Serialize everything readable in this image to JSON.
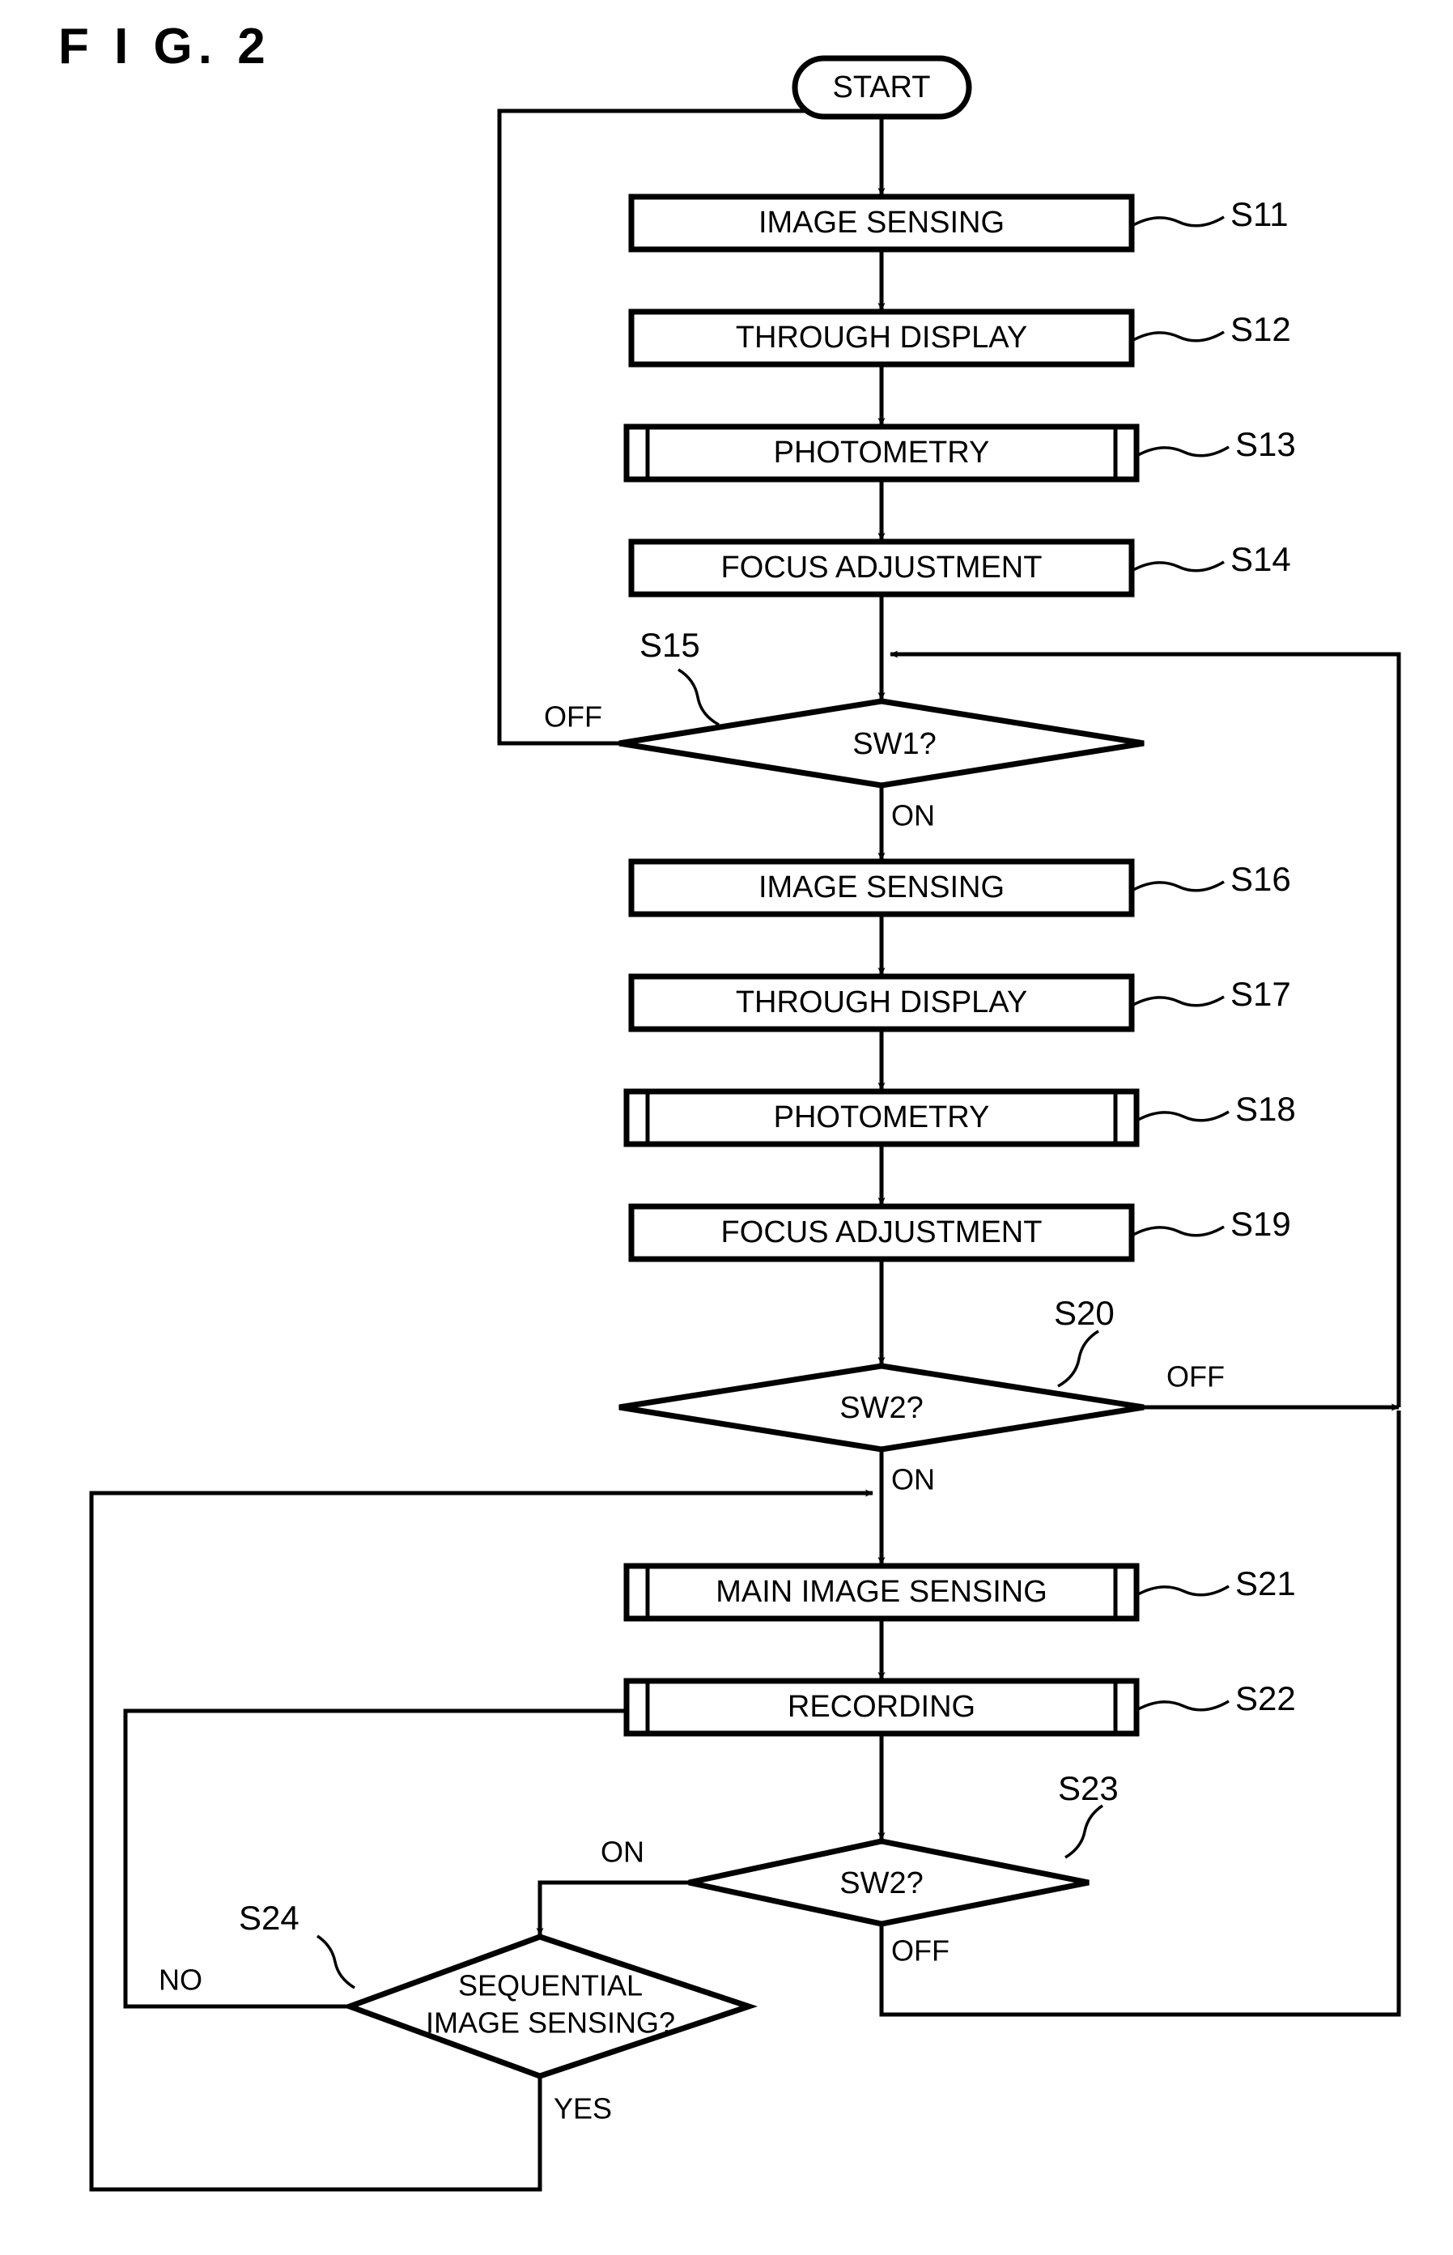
{
  "figure": {
    "title": "F I G.  2"
  },
  "flowchart": {
    "terminal_start": "START",
    "nodes": [
      {
        "id": "S11",
        "text": "IMAGE SENSING",
        "step": "S11",
        "shape": "process"
      },
      {
        "id": "S12",
        "text": "THROUGH DISPLAY",
        "step": "S12",
        "shape": "process"
      },
      {
        "id": "S13",
        "text": "PHOTOMETRY",
        "step": "S13",
        "shape": "predefined-process"
      },
      {
        "id": "S14",
        "text": "FOCUS ADJUSTMENT",
        "step": "S14",
        "shape": "process"
      },
      {
        "id": "S15",
        "text": "SW1?",
        "step": "S15",
        "shape": "decision"
      },
      {
        "id": "S16",
        "text": "IMAGE SENSING",
        "step": "S16",
        "shape": "process"
      },
      {
        "id": "S17",
        "text": "THROUGH DISPLAY",
        "step": "S17",
        "shape": "process"
      },
      {
        "id": "S18",
        "text": "PHOTOMETRY",
        "step": "S18",
        "shape": "predefined-process"
      },
      {
        "id": "S19",
        "text": "FOCUS ADJUSTMENT",
        "step": "S19",
        "shape": "process"
      },
      {
        "id": "S20",
        "text": "SW2?",
        "step": "S20",
        "shape": "decision"
      },
      {
        "id": "S21",
        "text": "MAIN IMAGE SENSING",
        "step": "S21",
        "shape": "predefined-process"
      },
      {
        "id": "S22",
        "text": "RECORDING",
        "step": "S22",
        "shape": "predefined-process"
      },
      {
        "id": "S23",
        "text": "SW2?",
        "step": "S23",
        "shape": "decision"
      },
      {
        "id": "S24",
        "text_line1": "SEQUENTIAL",
        "text_line2": "IMAGE SENSING?",
        "step": "S24",
        "shape": "decision"
      }
    ],
    "branch_labels": {
      "s15_off": "OFF",
      "s15_on": "ON",
      "s20_off": "OFF",
      "s20_on": "ON",
      "s23_on": "ON",
      "s23_off": "OFF",
      "s24_no": "NO",
      "s24_yes": "YES"
    },
    "colors": {
      "stroke": "#000000",
      "fill": "#ffffff"
    }
  }
}
